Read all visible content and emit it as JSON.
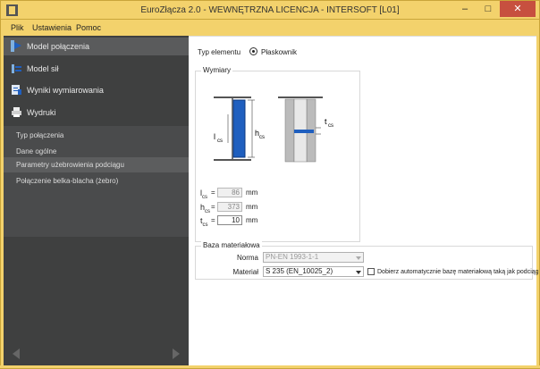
{
  "window": {
    "title": "EuroZłącza 2.0 - WEWNĘTRZNA LICENCJA - INTERSOFT [L01]",
    "min": "–",
    "max": "□",
    "close": "✕"
  },
  "menu": {
    "items": [
      "Plik",
      "Ustawienia",
      "Pomoc"
    ]
  },
  "sidebar": {
    "items": [
      {
        "label": "Model połączenia",
        "icon": "connection-model-icon",
        "active": true
      },
      {
        "label": "Model sił",
        "icon": "force-model-icon",
        "active": false
      },
      {
        "label": "Wyniki wymiarowania",
        "icon": "results-icon",
        "active": false
      },
      {
        "label": "Wydruki",
        "icon": "printer-icon",
        "active": false
      }
    ],
    "subitems": [
      {
        "label": "Typ połączenia",
        "active": false
      },
      {
        "label": "Dane ogólne",
        "active": false
      },
      {
        "label": "Parametry użebrowienia podciągu",
        "active": true
      },
      {
        "label": "Połączenie belka-blacha (żebro)",
        "active": false
      }
    ]
  },
  "main": {
    "element_type_label": "Typ elementu",
    "element_type_option": "Płaskownik",
    "dimensions": {
      "title": "Wymiary",
      "diagram": {
        "l_label": "l",
        "h_label": "h",
        "t_label": "t",
        "sub": "cs"
      },
      "fields": [
        {
          "symbol": "l",
          "sub": "cs",
          "value": "86",
          "unit": "mm",
          "editable": false
        },
        {
          "symbol": "h",
          "sub": "cs",
          "value": "373",
          "unit": "mm",
          "editable": false
        },
        {
          "symbol": "t",
          "sub": "cs",
          "value": "10",
          "unit": "mm",
          "editable": true
        }
      ]
    },
    "material": {
      "title": "Baza materiałowa",
      "norm_label": "Norma",
      "norm_value": "PN-EN 1993-1-1",
      "material_label": "Materiał",
      "material_value": "S 235 (EN_10025_2)",
      "auto_label": "Dobierz automatycznie bazę materiałową taką jak podciąg"
    }
  },
  "colors": {
    "titlebar": "#f3d26c",
    "sidebar": "#3f4040",
    "accent_blue": "#1f5fbf",
    "close": "#c7503f"
  }
}
